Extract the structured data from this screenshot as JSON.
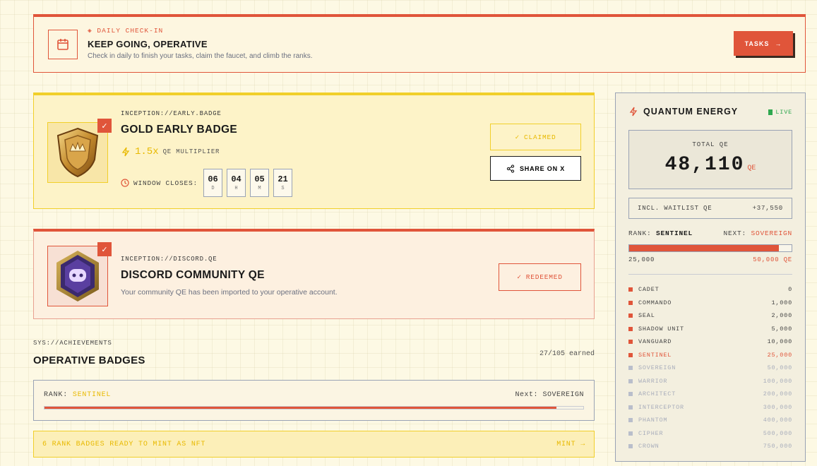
{
  "checkin": {
    "kicker": "◈ DAILY CHECK-IN",
    "title": "KEEP GOING, OPERATIVE",
    "subtitle": "Check in daily to finish your tasks, claim the faucet, and climb the ranks.",
    "tasks_label": "TASKS",
    "icon": "calendar-icon"
  },
  "gold_badge": {
    "kicker": "INCEPTION://EARLY.BADGE",
    "title": "GOLD EARLY BADGE",
    "multiplier_value": "1.5x",
    "multiplier_label": "QE MULTIPLIER",
    "window_label": "WINDOW CLOSES:",
    "countdown": [
      {
        "value": "06",
        "unit": "D"
      },
      {
        "value": "04",
        "unit": "H"
      },
      {
        "value": "05",
        "unit": "M"
      },
      {
        "value": "21",
        "unit": "S"
      }
    ],
    "claimed_label": "CLAIMED",
    "share_label": "SHARE ON X"
  },
  "discord": {
    "kicker": "INCEPTION://DISCORD.QE",
    "title": "DISCORD COMMUNITY QE",
    "description": "Your community QE has been imported to your operative account.",
    "redeemed_label": "REDEEMED"
  },
  "achievements": {
    "kicker": "SYS://ACHIEVEMENTS",
    "title": "OPERATIVE BADGES",
    "earned": "27/105 earned",
    "rank_label": "RANK:",
    "rank_value": "SENTINEL",
    "next_label": "Next:",
    "next_value": "SOVEREIGN",
    "progress": 0.95,
    "mint_label": "6 RANK BADGES READY TO MINT AS NFT",
    "mint_action": "MINT →"
  },
  "qe": {
    "title": "QUANTUM ENERGY",
    "live": "LIVE",
    "total_label": "TOTAL QE",
    "total_value": "48,110",
    "total_unit": "QE",
    "waitlist_label": "INCL. WAITLIST QE",
    "waitlist_value": "+37,550",
    "rank_label": "RANK:",
    "rank_value": "SENTINEL",
    "next_label": "NEXT:",
    "next_value": "SOVEREIGN",
    "progress": 0.92,
    "bar_min": "25,000",
    "bar_max": "50,000 QE",
    "tiers": [
      {
        "name": "CADET",
        "amount": "0",
        "state": "done"
      },
      {
        "name": "COMMANDO",
        "amount": "1,000",
        "state": "done"
      },
      {
        "name": "SEAL",
        "amount": "2,000",
        "state": "done"
      },
      {
        "name": "SHADOW UNIT",
        "amount": "5,000",
        "state": "done"
      },
      {
        "name": "VANGUARD",
        "amount": "10,000",
        "state": "done"
      },
      {
        "name": "SENTINEL",
        "amount": "25,000",
        "state": "current"
      },
      {
        "name": "SOVEREIGN",
        "amount": "50,000",
        "state": "locked"
      },
      {
        "name": "WARRIOR",
        "amount": "100,000",
        "state": "locked"
      },
      {
        "name": "ARCHITECT",
        "amount": "200,000",
        "state": "locked"
      },
      {
        "name": "INTERCEPTOR",
        "amount": "300,000",
        "state": "locked"
      },
      {
        "name": "PHANTOM",
        "amount": "400,000",
        "state": "locked"
      },
      {
        "name": "CIPHER",
        "amount": "500,000",
        "state": "locked"
      },
      {
        "name": "CROWN",
        "amount": "750,000",
        "state": "locked"
      }
    ]
  },
  "colors": {
    "accent": "#e0553a",
    "gold": "#f1cf2a",
    "live": "#2fa84f"
  }
}
